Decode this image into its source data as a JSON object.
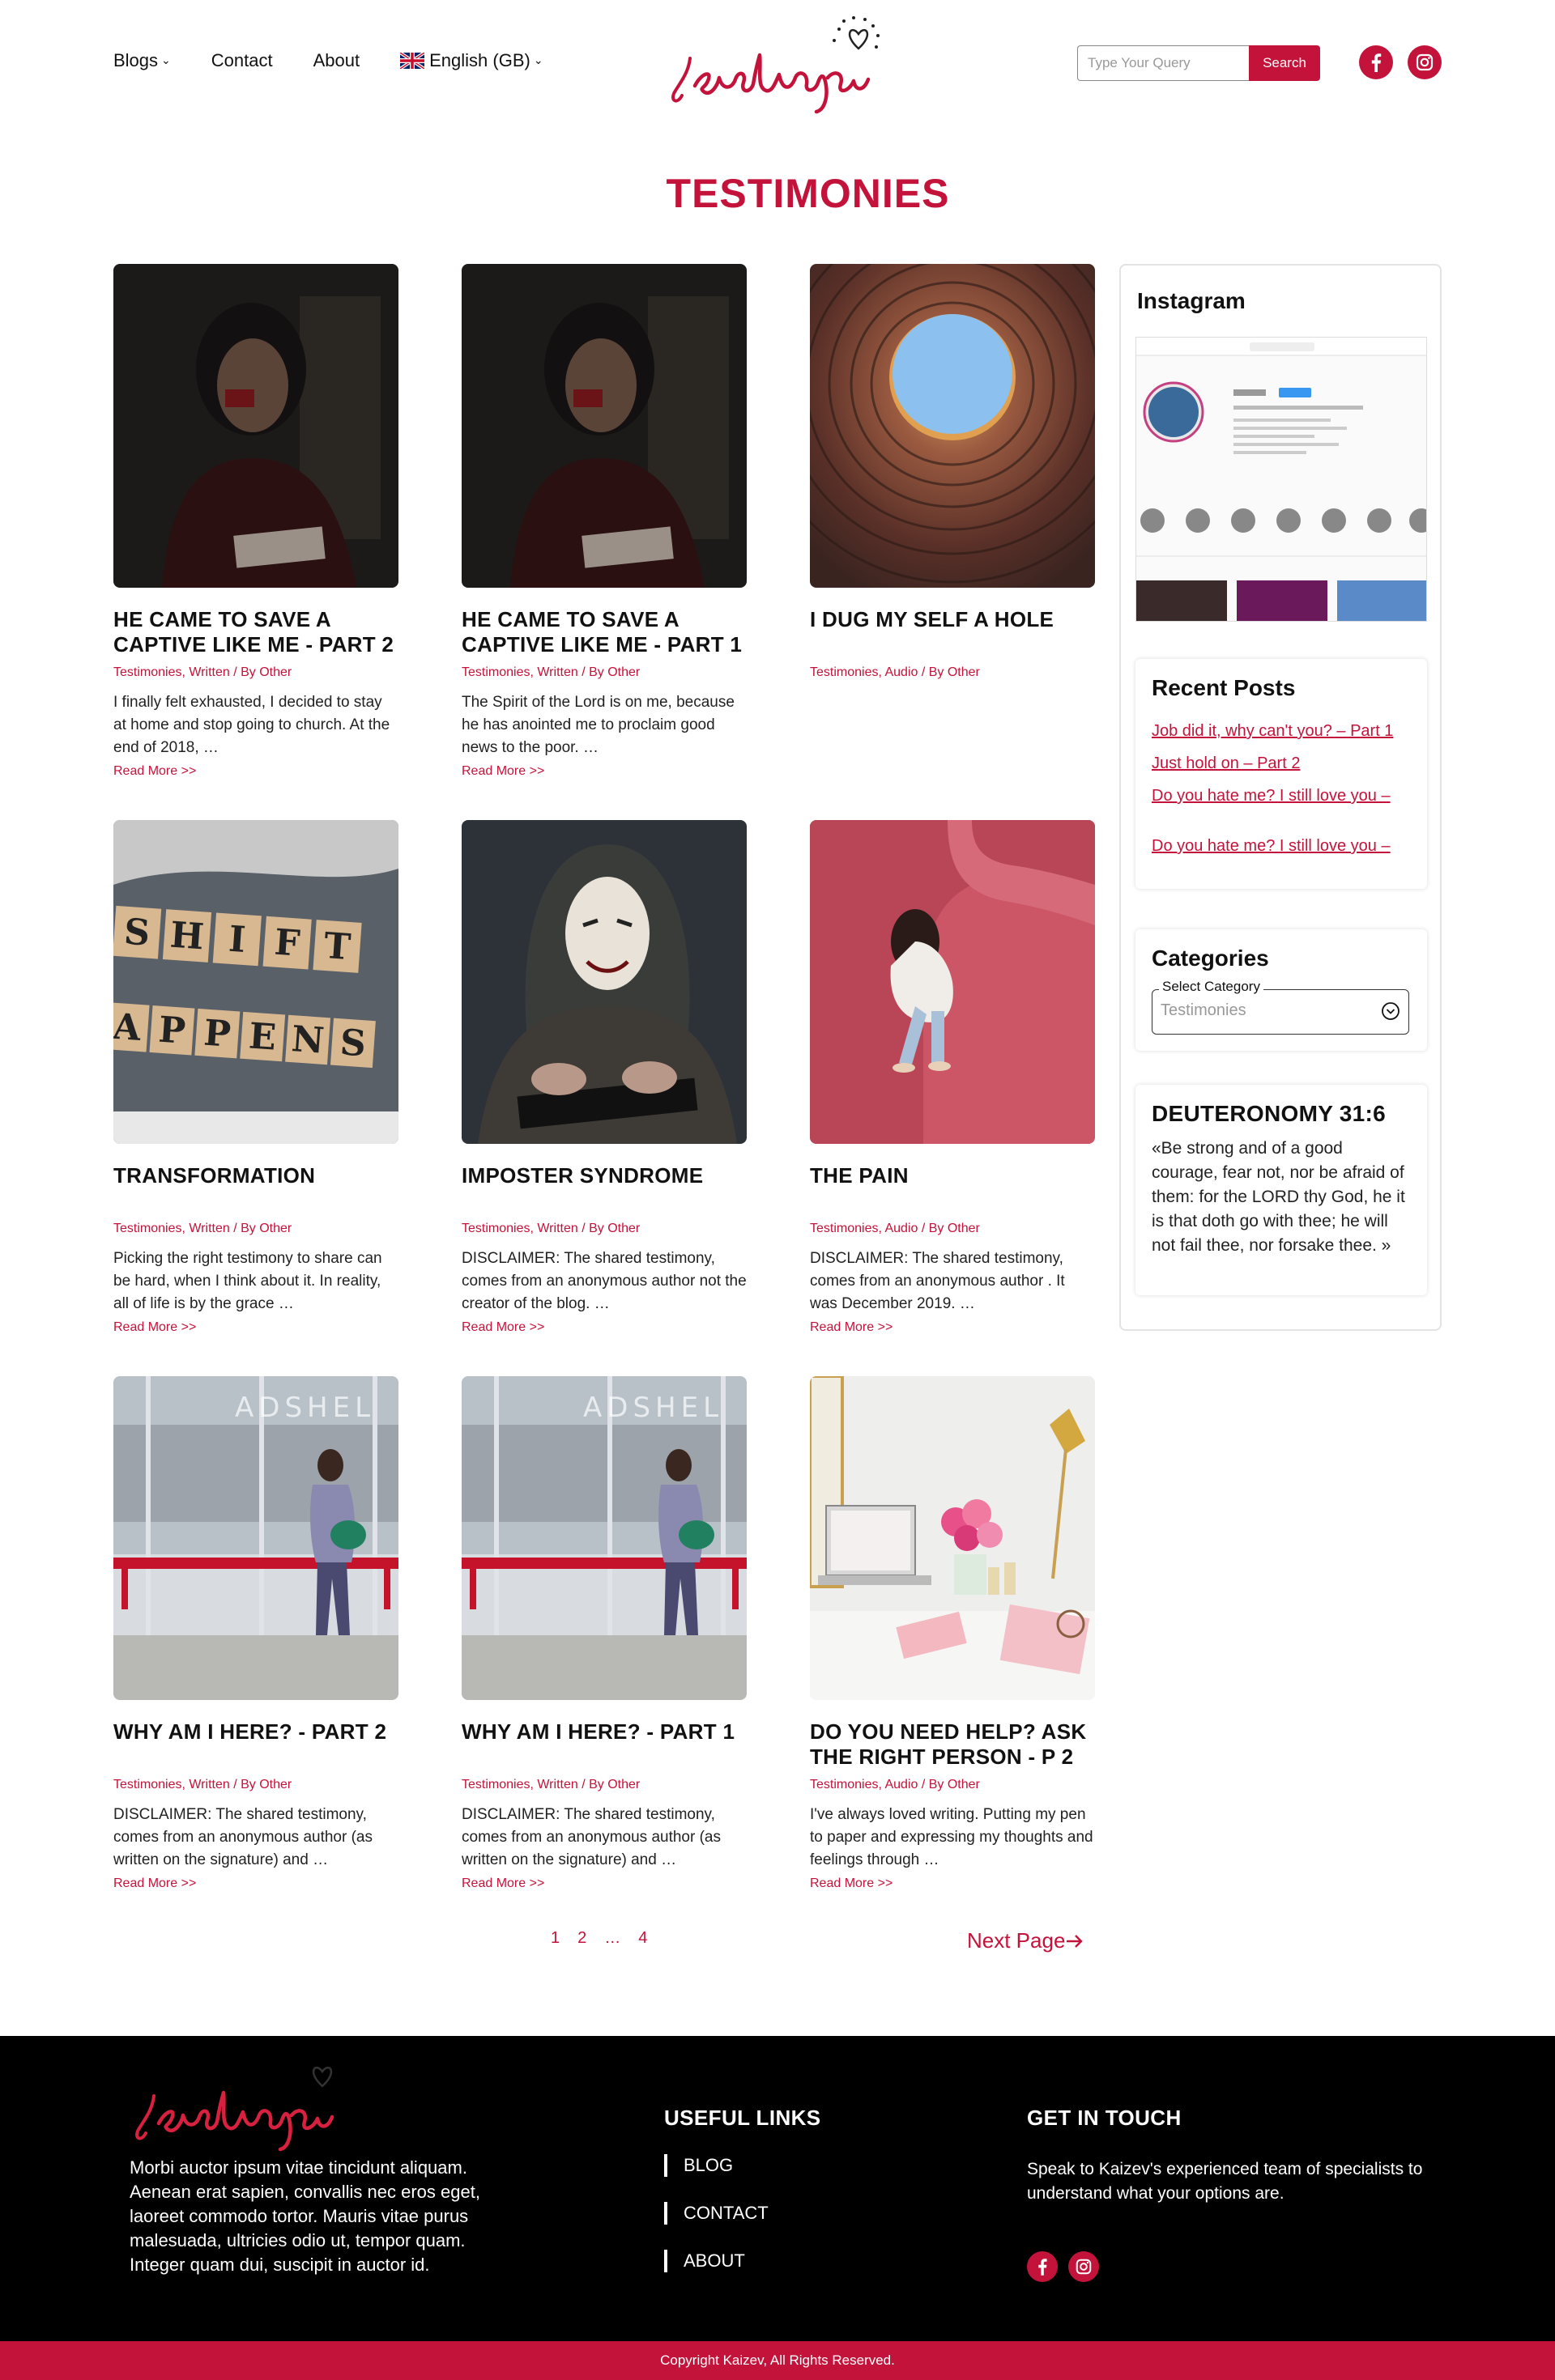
{
  "header": {
    "nav": [
      {
        "label": "Blogs",
        "has_dropdown": true
      },
      {
        "label": "Contact",
        "has_dropdown": false
      },
      {
        "label": "About",
        "has_dropdown": false
      }
    ],
    "language": "English (GB)",
    "logo_text": "jesuslovesyou",
    "search_placeholder": "Type Your Query",
    "search_button": "Search",
    "social_icons": [
      "facebook-icon",
      "instagram-icon"
    ]
  },
  "page_title": "TESTIMONIES",
  "posts": [
    {
      "title": "HE CAME TO SAVE A CAPTIVE LIKE ME - PART 2",
      "meta": "Testimonies, Written / By Other",
      "excerpt": "I finally felt exhausted, I decided to stay at home and stop going to church. At the end of 2018, …",
      "read_more": "Read More >>"
    },
    {
      "title": "HE CAME TO SAVE A CAPTIVE LIKE ME - PART 1",
      "meta": "Testimonies, Written / By Other",
      "excerpt": "The Spirit of the Lord is on me, because he has anointed me to proclaim good news to the poor. …",
      "read_more": "Read More >>"
    },
    {
      "title": "I DUG MY SELF A HOLE",
      "meta": "Testimonies, Audio / By Other",
      "excerpt": "",
      "read_more": ""
    },
    {
      "title": "TRANSFORMATION",
      "meta": "Testimonies, Written / By Other",
      "excerpt": "Picking the right testimony to share can be hard, when I think about it. In reality, all of life is by the grace …",
      "read_more": "Read More >>"
    },
    {
      "title": "IMPOSTER SYNDROME",
      "meta": "Testimonies, Written / By Other",
      "excerpt": "DISCLAIMER: The shared testimony, comes from an anonymous author not the creator of the blog. …",
      "read_more": "Read More >>"
    },
    {
      "title": "THE PAIN",
      "meta": "Testimonies, Audio / By Other",
      "excerpt": "DISCLAIMER: The shared testimony, comes from an anonymous author . It was December 2019. …",
      "read_more": "Read More >>"
    },
    {
      "title": "WHY AM I HERE? - PART 2",
      "meta": "Testimonies, Written / By Other",
      "excerpt": "DISCLAIMER: The shared testimony, comes from an anonymous author (as written on the signature) and …",
      "read_more": "Read More >>"
    },
    {
      "title": "WHY AM I HERE? - PART 1",
      "meta": "Testimonies, Written / By Other",
      "excerpt": "DISCLAIMER: The shared testimony, comes from an anonymous author (as written on the signature) and …",
      "read_more": "Read More >>"
    },
    {
      "title": "DO YOU NEED HELP? ASK THE RIGHT PERSON - P 2",
      "meta": "Testimonies, Audio / By Other",
      "excerpt": "I've always loved writing. Putting my pen to paper and expressing my thoughts and feelings through …",
      "read_more": "Read More >>"
    }
  ],
  "sidebar": {
    "instagram_title": "Instagram",
    "recent_title": "Recent Posts",
    "recent_posts": [
      "Job did it, why can't you? – Part 1",
      "Just hold on – Part 2",
      "Do you hate me? I still love you –",
      "Do you hate me? I still love you –"
    ],
    "categories_title": "Categories",
    "categories_label": "Select Category",
    "categories_value": "Testimonies",
    "verse_title": "DEUTERONOMY 31:6",
    "verse_text": "«Be strong and of a good courage, fear not, nor be afraid of them: for the LORD thy God, he it is that doth go with thee; he will not fail thee, nor forsake thee. »"
  },
  "pagination": {
    "pages": [
      "1",
      "2",
      "…",
      "4"
    ],
    "next": "Next Page"
  },
  "footer": {
    "about": "Morbi auctor ipsum vitae tincidunt aliquam. Aenean erat sapien, convallis nec eros eget, laoreet commodo tortor. Mauris vitae purus malesuada, ultricies odio ut, tempor quam. Integer quam dui, suscipit in auctor id.",
    "useful_title": "USEFUL LINKS",
    "links": [
      "BLOG",
      "CONTACT",
      "ABOUT"
    ],
    "touch_title": "GET IN TOUCH",
    "touch_text": "Speak to Kaizev's experienced team of specialists to understand what your options are.",
    "copyright": "Copyright Kaizev, All Rights Reserved."
  },
  "colors": {
    "accent": "#c4133a",
    "footer_bg": "#000000"
  }
}
